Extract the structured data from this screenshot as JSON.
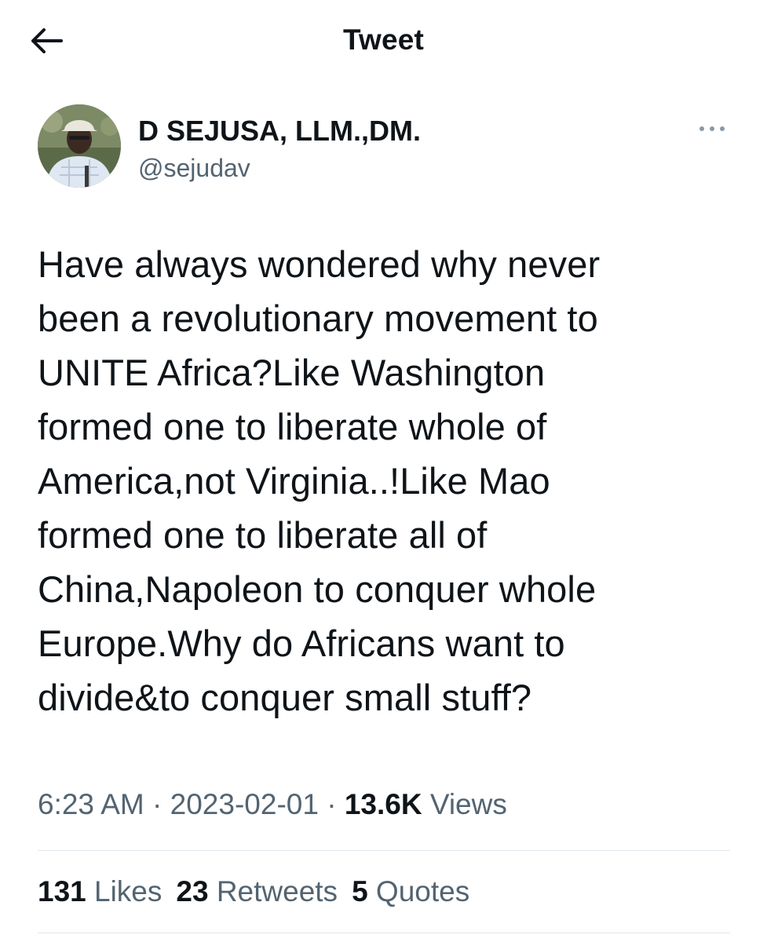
{
  "header": {
    "title": "Tweet",
    "back_icon": "arrow-left-icon"
  },
  "author": {
    "display_name": "D SEJUSA, LLM.,DM.",
    "handle": "@sejudav"
  },
  "more_icon": "more-horizontal-icon",
  "tweet": {
    "text": "Have always wondered why never\nbeen a revolutionary movement to\nUNITE Africa?Like Washington\nformed one to liberate whole of\nAmerica,not Virginia..!Like Mao\nformed one to liberate all of\nChina,Napoleon to conquer whole\nEurope.Why do Africans want to\ndivide&to conquer small stuff?"
  },
  "meta": {
    "time": "6:23 AM",
    "separator": " · ",
    "date": "2023-02-01",
    "views_count": "13.6K",
    "views_label": " Views"
  },
  "stats": {
    "likes_count": "131",
    "likes_label": " Likes",
    "retweets_count": "23",
    "retweets_label": " Retweets",
    "quotes_count": "5",
    "quotes_label": " Quotes"
  },
  "colors": {
    "primary_text": "#0f1419",
    "secondary_text": "#536471",
    "divider": "#e1e8ed"
  }
}
